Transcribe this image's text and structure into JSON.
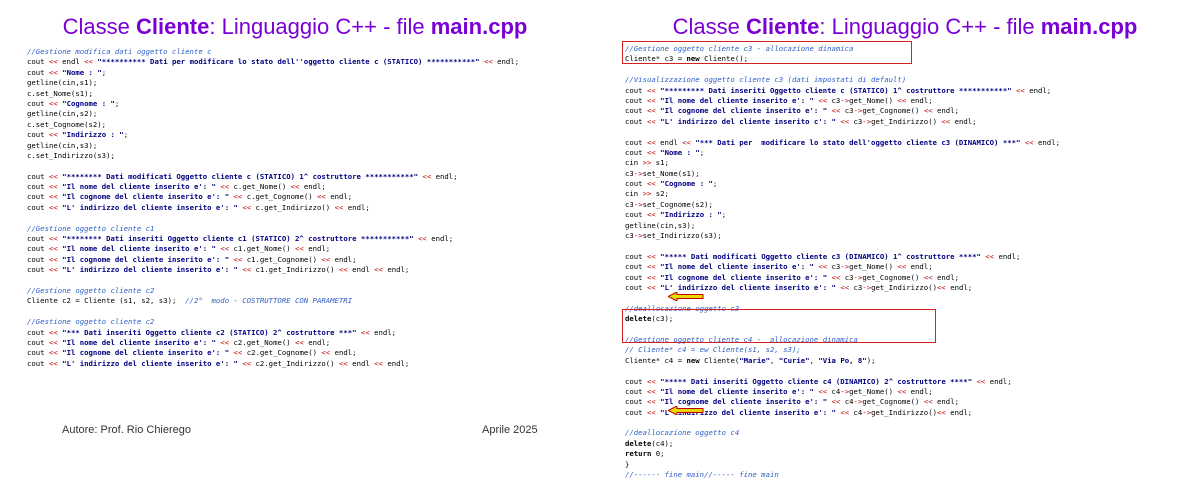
{
  "left": {
    "title_prefix": "Classe ",
    "title_class": "Cliente",
    "title_mid": ": Linguaggio C++ - file ",
    "title_file": "main.cpp",
    "lines": [
      "//Gestione modifica dati oggetto cliente c",
      "cout << endl << \"********** Dati per modificare lo stato dell''oggetto cliente c (STATICO) ***********\" << endl;",
      "cout << \"Nome : \";",
      "getline(cin,s1);",
      "c.set_Nome(s1);",
      "cout << \"Cognome : \";",
      "getline(cin,s2);",
      "c.set_Cognome(s2);",
      "cout << \"Indirizzo : \";",
      "getline(cin,s3);",
      "c.set_Indirizzo(s3);",
      "",
      "cout << \"******** Dati modificati Oggetto cliente c (STATICO) 1^ costruttore ***********\" << endl;",
      "cout << \"Il nome del cliente inserito e': \" << c.get_Nome() << endl;",
      "cout << \"Il cognome del cliente inserito e': \" << c.get_Cognome() << endl;",
      "cout << \"L' indirizzo del cliente inserito e': \" << c.get_Indirizzo() << endl;",
      "",
      "//Gestione oggetto cliente c1",
      "cout << \"******** Dati inseriti Oggetto cliente c1 (STATICO) 2^ costruttore ***********\" << endl;",
      "cout << \"Il nome del cliente inserito e': \" << c1.get_Nome() << endl;",
      "cout << \"Il cognome del cliente inserito e': \" << c1.get_Cognome() << endl;",
      "cout << \"L' indirizzo del cliente inserito e': \" << c1.get_Indirizzo() << endl << endl;",
      "",
      "//Gestione oggetto cliente c2",
      "Cliente c2 = Cliente (s1, s2, s3);  //2°  modo - COSTRUTTORE CON PARAMETRI",
      "",
      "//Gestione oggetto cliente c2",
      "cout << \"*** Dati inseriti Oggetto cliente c2 (STATICO) 2^ costruttore ***\" << endl;",
      "cout << \"Il nome del cliente inserito e': \" << c2.get_Nome() << endl;",
      "cout << \"Il cognome del cliente inserito e': \" << c2.get_Cognome() << endl;",
      "cout << \"L' indirizzo del cliente inserito e': \" << c2.get_Indirizzo() << endl << endl;"
    ],
    "footer_author": "Autore: Prof. Rio Chierego",
    "footer_date": "Aprile 2025"
  },
  "right": {
    "title_prefix": "Classe ",
    "title_class": "Cliente",
    "title_mid": ": Linguaggio C++ - file ",
    "title_file": "main.cpp",
    "lines": [
      "//Gestione oggetto cliente c3 - allocazione dinamica",
      "Cliente* c3 = new Cliente();",
      "",
      "//Visualizzazione oggetto cliente c3 (dati impostati di default)",
      "cout << \"********* Dati inseriti Oggetto cliente c (STATICO) 1^ costruttore ***********\" << endl;",
      "cout << \"Il nome del cliente inserito e': \" << c3->get_Nome() << endl;",
      "cout << \"Il cognome del cliente inserito e': \" << c3->get_Cognome() << endl;",
      "cout << \"L' indirizzo del cliente inserito c': \" << c3->get_Indirizzo() << endl;",
      "",
      "cout << endl << \"*** Dati per  modificare lo stato dell'oggetto cliente c3 (DINAMICO) ***\" << endl;",
      "cout << \"Nome : \";",
      "cin >> s1;",
      "c3->set_Nome(s1);",
      "cout << \"Cognome : \";",
      "cin >> s2;",
      "c3->set_Cognome(s2);",
      "cout << \"Indirizzo : \";",
      "getline(cin,s3);",
      "c3->set_Indirizzo(s3);",
      "",
      "cout << \"***** Dati modificati Oggetto cliente c3 (DINAMICO) 1^ costruttore ****\" << endl;",
      "cout << \"Il nome del cliente inserito e': \" << c3->get_Nome() << endl;",
      "cout << \"Il cognome del cliente inserito e': \" << c3->get_Cognome() << endl;",
      "cout << \"L' indirizzo del cliente inserito e': \" << c3->get_Indirizzo()<< endl;",
      "",
      "//deallocazione oggetto c3",
      "delete(c3);",
      "",
      "//Gestione oggetto cliente c4 -  allocazione dinamica",
      "// Cliente* c4 = ew Cliente(s1, s2, s3);",
      "Cliente* c4 = new Cliente(\"Marie\", \"Curie\", \"Via Po, 8\");",
      "",
      "cout << \"***** Dati inseriti Oggetto cliente c4 (DINAMICO) 2^ costruttore ****\" << endl;",
      "cout << \"Il nome del cliente inserito e': \" << c4->get_Nome() << endl;",
      "cout << \"Il cognome del cliente inserito e': \" << c4->get_Cognome() << endl;",
      "cout << \"L' indirizzo del cliente inserito e': \" << c4->get_Indirizzo()<< endl;",
      "",
      "//deallocazione oggetto c4",
      "delete(c4);",
      "return 0;",
      "}",
      "//------ fine main//----- fine main"
    ]
  },
  "colors": {
    "title": "#7a00d6",
    "highlight_box": "#d62020",
    "arrow_fill": "#e8d800",
    "arrow_stroke": "#c00000"
  }
}
